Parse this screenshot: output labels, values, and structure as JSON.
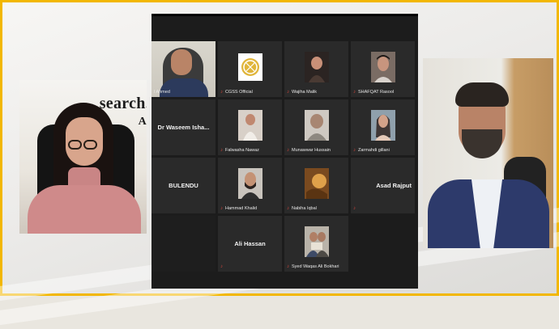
{
  "gallery": {
    "tiles": [
      {
        "id": "t1",
        "label": "l Ahmed",
        "type": "video",
        "active": true
      },
      {
        "id": "t2",
        "label": "CGSS Official",
        "type": "logo"
      },
      {
        "id": "t3",
        "label": "Wajiha Malik",
        "type": "photo"
      },
      {
        "id": "t4",
        "label": "SHAFQAT Rasool",
        "type": "photo"
      },
      {
        "id": "t5",
        "label": "Dr Waseem Isha...",
        "type": "name"
      },
      {
        "id": "t6",
        "label": "Falwasha Nawaz",
        "type": "photo"
      },
      {
        "id": "t7",
        "label": "Munawwar Hussain",
        "type": "photo"
      },
      {
        "id": "t8",
        "label": "Zarmahdi gillani",
        "type": "photo"
      },
      {
        "id": "t9",
        "label": "BULENDU",
        "type": "name"
      },
      {
        "id": "t10",
        "label": "Hammad Khalid",
        "type": "photo"
      },
      {
        "id": "t11",
        "label": "Nabiha Iqbal",
        "type": "photo"
      },
      {
        "id": "t12",
        "label": "Asad Rajput",
        "type": "name"
      },
      {
        "id": "t13",
        "label": "",
        "type": "empty"
      },
      {
        "id": "t14",
        "label": "Ali Hassan",
        "type": "name"
      },
      {
        "id": "t15",
        "label": "Syed Waqas Ali Bokhari",
        "type": "photo"
      }
    ]
  },
  "left_cam": {
    "sign_line1": "search.",
    "sign_line2": "Ac"
  },
  "colors": {
    "border": "#f2b700",
    "active_outline": "#e6e83a",
    "muted": "#e0463c"
  }
}
